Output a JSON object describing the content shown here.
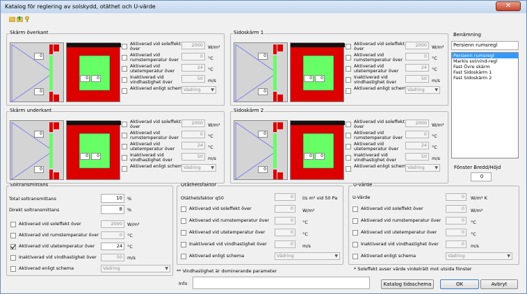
{
  "window": {
    "title": "Katalog för reglering av solskydd, otäthet och U-värde",
    "close_label": "✕"
  },
  "toolbar": {
    "icons": [
      "folder-open-icon",
      "save-icon",
      "key-icon"
    ]
  },
  "panels": [
    {
      "label": "Skärm överkant",
      "rows": [
        {
          "label": "Aktiverad vid soleffekt över",
          "value": "2000",
          "unit": "W/m²"
        },
        {
          "label": "Aktiverad vid rumstemperatur över",
          "value": "0",
          "unit": "°C"
        },
        {
          "label": "Aktiverad vid utetemperatur över",
          "value": "24",
          "unit": "°C"
        },
        {
          "label": "Inaktiverad vid vindhastighet över",
          "value": "50",
          "unit": "m/s"
        },
        {
          "label": "Aktiverad enligt schema",
          "value": "Vädring",
          "unit": ""
        }
      ],
      "preview": {
        "small1": "0",
        "small2": "0",
        "small3": "0",
        "small4": "0"
      }
    },
    {
      "label": "Sidoskärm 1",
      "rows": [
        {
          "label": "Aktiverad vid soleffekt över",
          "value": "2000",
          "unit": "W/m²"
        },
        {
          "label": "Aktiverad vid rumstemperatur över",
          "value": "0",
          "unit": "°C"
        },
        {
          "label": "Aktiverad vid utetemperatur över",
          "value": "24",
          "unit": "°C"
        },
        {
          "label": "Inaktiverad vid vindhastighet över",
          "value": "50",
          "unit": "m/s"
        },
        {
          "label": "Aktiverad enligt schema",
          "value": "Vädring",
          "unit": ""
        }
      ],
      "preview": {
        "small1": "0",
        "small2": "0",
        "small3": "0",
        "small4": "0"
      }
    },
    {
      "label": "Skärm underkant",
      "rows": [
        {
          "label": "Aktiverad vid soleffekt över",
          "value": "2000",
          "unit": "W/m²"
        },
        {
          "label": "Aktiverad vid rumstemperatur över",
          "value": "0",
          "unit": "°C"
        },
        {
          "label": "Aktiverad vid utetemperatur över",
          "value": "24",
          "unit": "°C"
        },
        {
          "label": "Inaktiverad vid vindhastighet över",
          "value": "50",
          "unit": "m/s"
        },
        {
          "label": "Aktiverad enligt schema",
          "value": "Vädring",
          "unit": ""
        }
      ],
      "preview": {
        "small1": "0",
        "small2": "0",
        "small3": "0",
        "small4": "0"
      }
    },
    {
      "label": "Sidoskärm 2",
      "rows": [
        {
          "label": "Aktiverad vid soleffekt över",
          "value": "2000",
          "unit": "W/m²"
        },
        {
          "label": "Aktiverad vid rumstemperatur över",
          "value": "0",
          "unit": "°C"
        },
        {
          "label": "Aktiverad vid utetemperatur över",
          "value": "24",
          "unit": "°C"
        },
        {
          "label": "Inaktiverad vid vindhastighet över",
          "value": "50",
          "unit": "m/s"
        },
        {
          "label": "Aktiverad enligt schema",
          "value": "Vädring",
          "unit": ""
        }
      ],
      "preview": {
        "small1": "0",
        "small2": "0",
        "small3": "0",
        "small4": "0"
      }
    }
  ],
  "benamning": {
    "label": "Benämning",
    "value": "Persienn rumsregl",
    "items": [
      "Persienn rumsregl",
      "Markis sol/vind-regl",
      "Fast Övre skärm",
      "Fast Sidoskärm 1",
      "Fast Sidoskärm 2"
    ]
  },
  "fonster": {
    "label": "Fönster Bredd/Höjd",
    "value": "0"
  },
  "soltrans": {
    "label": "Soltransmittans",
    "total": {
      "label": "Total soltransmittans",
      "value": "10",
      "unit": "%"
    },
    "direkt": {
      "label": "Direkt soltransmittans",
      "value": "8",
      "unit": "%"
    },
    "rows": [
      {
        "label": "Aktiverad vid soleffekt över",
        "value": "2000",
        "unit": "W/m²",
        "checked": false
      },
      {
        "label": "Aktiverad vid rumstemperatur över",
        "value": "0",
        "unit": "°C",
        "checked": false
      },
      {
        "label": "Aktiverad vid utetemperatur över",
        "value": "24",
        "unit": "°C",
        "checked": true
      },
      {
        "label": "Inaktiverad vid vindhastighet över",
        "value": "50",
        "unit": "m/s",
        "checked": false
      },
      {
        "label": "Aktiverad enligt schema",
        "value": "Vädring",
        "unit": "",
        "checked": false
      }
    ]
  },
  "otathet": {
    "label": "Otäthetsfaktor",
    "q50": {
      "label": "Otäthetsfaktor q50",
      "value": "0",
      "unit": "l/s m² vid 50 Pa"
    },
    "rows": [
      {
        "label": "Aktiverad vid soleffekt över",
        "value": "0",
        "unit": "W/m²"
      },
      {
        "label": "Aktiverad vid rumstemperatur över",
        "value": "0",
        "unit": "°C"
      },
      {
        "label": "Aktiverad vid utetemperatur över",
        "value": "0",
        "unit": "°C"
      },
      {
        "label": "Inaktiverad vid vindhastighet över",
        "value": "0",
        "unit": "m/s"
      },
      {
        "label": "Aktiverad enligt schema",
        "value": "Vädring",
        "unit": ""
      }
    ]
  },
  "uvarde": {
    "label": "U-värde",
    "u": {
      "label": "U-Värde",
      "value": "0",
      "unit": "W/m² K"
    },
    "rows": [
      {
        "label": "Aktiverad vid soleffekt över",
        "value": "0",
        "unit": "W/m²"
      },
      {
        "label": "Aktiverad vid rumstemperatur över",
        "value": "0",
        "unit": "°C"
      },
      {
        "label": "Aktiverad vid utetemperatur över",
        "value": "0",
        "unit": "°C"
      },
      {
        "label": "Inaktiverad vid vindhastighet över",
        "value": "0",
        "unit": "m/s"
      },
      {
        "label": "Aktiverad enligt schema",
        "value": "Vädring",
        "unit": ""
      }
    ]
  },
  "footnotes": {
    "wind": "** Vindhastighet är dominerande parameter",
    "sol": "*  Soleffekt avser värde vinkelrätt mot utsida fönster"
  },
  "info": {
    "label": "Info",
    "value": ""
  },
  "buttons": {
    "katalog": "Katalog tidsschema",
    "ok": "OK",
    "avbryt": "Avbryt"
  },
  "colors": {
    "red": "#dc0000",
    "green": "#66ff66",
    "blue_line": "#5a5aff"
  }
}
